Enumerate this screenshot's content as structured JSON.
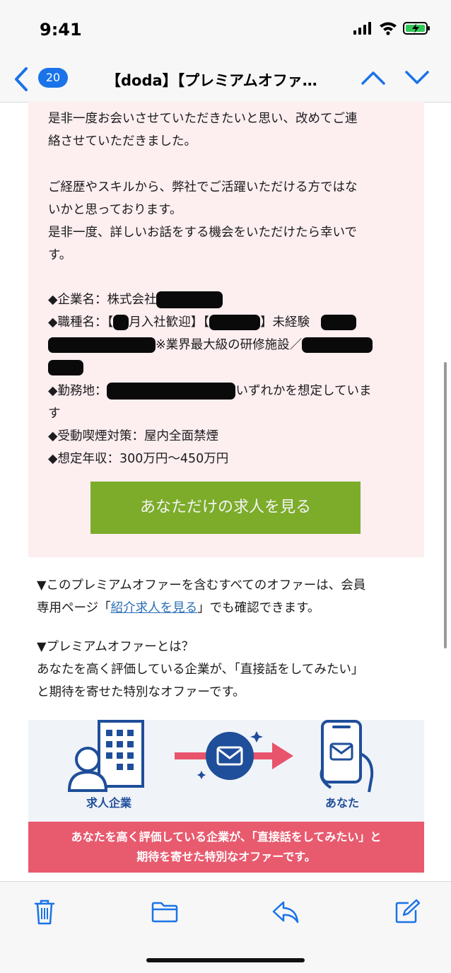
{
  "status": {
    "time": "9:41"
  },
  "nav": {
    "badge_count": "20",
    "title": "【doda】【プレミアムオファ…"
  },
  "body": {
    "lines": [
      "是非一度お会いさせていただきたいと思い、改めてご連",
      "絡させていただきました。",
      "ご経歴やスキルから、弊社でご活躍いただける方ではな",
      "いかと思っております。",
      "是非一度、詳しいお話をする機会をいただけたら幸いで",
      "す。"
    ],
    "company": "◆企業名：株式会社",
    "job_a": "◆職種名：【",
    "job_b": "月入社歓迎】【",
    "job_c": "】未経験",
    "job_d": "※業界最大級の研修施設／",
    "location_a": "◆勤務地：",
    "location_b": "いずれかを想定していま",
    "location_c": "す",
    "smoking": "◆受動喫煙対策：屋内全面禁煙",
    "salary": "◆想定年収：300万円〜450万円",
    "cta_label": "あなただけの求人を見る"
  },
  "after": {
    "line1": "▼このプレミアムオファーを含むすべてのオファーは、会員",
    "line2_pre": "専用ページ「",
    "line2_link": "紹介求人を見る",
    "line2_post": "」でも確認できます。",
    "q_title": "▼プレミアムオファーとは？",
    "q_line1": "あなたを高く評価している企業が、「直接話をしてみたい」",
    "q_line2": "と期待を寄せた特別なオファーです。"
  },
  "illustration": {
    "left_label": "求人企業",
    "right_label": "あなた",
    "banner_line1": "あなたを高く評価している企業が、「直接話をしてみたい」と",
    "banner_line2": "期待を寄せた特別なオファーです。"
  },
  "colors": {
    "accent": "#1a73e8",
    "cta": "#7cac2a",
    "pink_bg": "#fdeef0",
    "banner": "#e85a6e",
    "illustration_blue": "#1f4e9a",
    "arrow": "#e8546c"
  },
  "icons": [
    "signal-icon",
    "wifi-icon",
    "battery-charging-icon",
    "back-chevron-icon",
    "chevron-up-icon",
    "chevron-down-icon",
    "trash-icon",
    "folder-icon",
    "reply-icon",
    "compose-icon"
  ]
}
